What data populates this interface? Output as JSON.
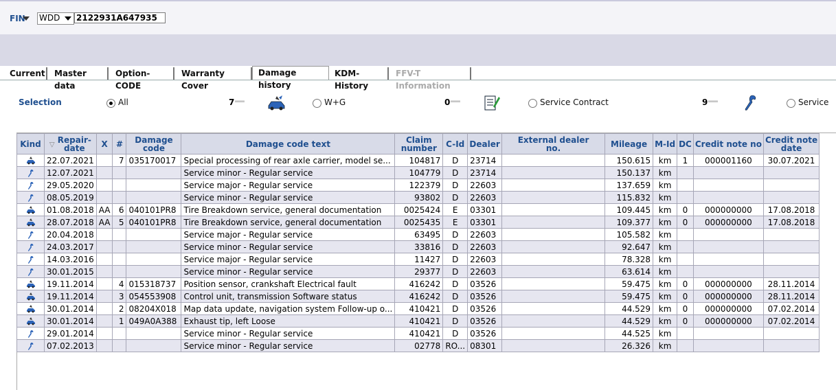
{
  "header": {
    "fin_label": "FIN",
    "model_select": "WDD",
    "vin_value": "2122931A647935"
  },
  "tabs": [
    {
      "label": "Current"
    },
    {
      "label": "Master data"
    },
    {
      "label": "Option-CODE"
    },
    {
      "label": "Warranty  Cover"
    },
    {
      "label": "Damage history"
    },
    {
      "label": "KDM-History"
    },
    {
      "label": "FFV-T Information"
    }
  ],
  "selection": {
    "label": "Selection",
    "options": [
      {
        "label": "All",
        "checked": true
      },
      {
        "label": "W+G",
        "checked": false
      },
      {
        "label": "Service Contract",
        "checked": false
      },
      {
        "label": "Service",
        "checked": false
      }
    ],
    "counts": [
      "7",
      "0",
      "9"
    ],
    "icons": [
      "damage-car-icon",
      "contract-document-icon",
      "wrench-icon"
    ]
  },
  "table": {
    "headers": [
      "Kind",
      "Repair-\ndate",
      "X",
      "#",
      "Damage\ncode",
      "Damage code text",
      "Claim\nnumber",
      "C-Id",
      "Dealer",
      "External dealer\nno.",
      "Mileage",
      "M-Id",
      "DC",
      "Credit note no",
      "Credit note\ndate"
    ],
    "rows": [
      {
        "kind": "damage",
        "date": "22.07.2021",
        "x": "",
        "num": "7",
        "code": "035170017",
        "text": "Special processing of rear axle carrier, model se...",
        "claim": "104817",
        "cid": "D",
        "dealer": "23714",
        "ext": "",
        "mileage": "150.615",
        "mid": "km",
        "dc": "1",
        "cn": "000001160",
        "cndate": "30.07.2021"
      },
      {
        "kind": "service",
        "date": "12.07.2021",
        "x": "",
        "num": "",
        "code": "",
        "text": "Service minor - Regular service",
        "claim": "104779",
        "cid": "D",
        "dealer": "23714",
        "ext": "",
        "mileage": "150.137",
        "mid": "km",
        "dc": "",
        "cn": "",
        "cndate": ""
      },
      {
        "kind": "service",
        "date": "29.05.2020",
        "x": "",
        "num": "",
        "code": "",
        "text": "Service major - Regular service",
        "claim": "122379",
        "cid": "D",
        "dealer": "22603",
        "ext": "",
        "mileage": "137.659",
        "mid": "km",
        "dc": "",
        "cn": "",
        "cndate": ""
      },
      {
        "kind": "service",
        "date": "08.05.2019",
        "x": "",
        "num": "",
        "code": "",
        "text": "Service minor - Regular service",
        "claim": "93802",
        "cid": "D",
        "dealer": "22603",
        "ext": "",
        "mileage": "115.832",
        "mid": "km",
        "dc": "",
        "cn": "",
        "cndate": ""
      },
      {
        "kind": "damage",
        "date": "01.08.2018",
        "x": "AA",
        "num": "6",
        "code": "040101PR8",
        "text": "Tire Breakdown service, general documentation",
        "claim": "0025424",
        "cid": "E",
        "dealer": "03301",
        "ext": "",
        "mileage": "109.445",
        "mid": "km",
        "dc": "0",
        "cn": "000000000",
        "cndate": "17.08.2018"
      },
      {
        "kind": "damage",
        "date": "28.07.2018",
        "x": "AA",
        "num": "5",
        "code": "040101PR8",
        "text": "Tire Breakdown service, general documentation",
        "claim": "0025435",
        "cid": "E",
        "dealer": "03301",
        "ext": "",
        "mileage": "109.377",
        "mid": "km",
        "dc": "0",
        "cn": "000000000",
        "cndate": "17.08.2018"
      },
      {
        "kind": "service",
        "date": "20.04.2018",
        "x": "",
        "num": "",
        "code": "",
        "text": "Service major - Regular service",
        "claim": "63495",
        "cid": "D",
        "dealer": "22603",
        "ext": "",
        "mileage": "105.582",
        "mid": "km",
        "dc": "",
        "cn": "",
        "cndate": ""
      },
      {
        "kind": "service",
        "date": "24.03.2017",
        "x": "",
        "num": "",
        "code": "",
        "text": "Service minor - Regular service",
        "claim": "33816",
        "cid": "D",
        "dealer": "22603",
        "ext": "",
        "mileage": "92.647",
        "mid": "km",
        "dc": "",
        "cn": "",
        "cndate": ""
      },
      {
        "kind": "service",
        "date": "14.03.2016",
        "x": "",
        "num": "",
        "code": "",
        "text": "Service major - Regular service",
        "claim": "11427",
        "cid": "D",
        "dealer": "22603",
        "ext": "",
        "mileage": "78.328",
        "mid": "km",
        "dc": "",
        "cn": "",
        "cndate": ""
      },
      {
        "kind": "service",
        "date": "30.01.2015",
        "x": "",
        "num": "",
        "code": "",
        "text": "Service minor - Regular service",
        "claim": "29377",
        "cid": "D",
        "dealer": "22603",
        "ext": "",
        "mileage": "63.614",
        "mid": "km",
        "dc": "",
        "cn": "",
        "cndate": ""
      },
      {
        "kind": "damage",
        "date": "19.11.2014",
        "x": "",
        "num": "4",
        "code": "015318737",
        "text": "Position sensor, crankshaft Electrical fault",
        "claim": "416242",
        "cid": "D",
        "dealer": "03526",
        "ext": "",
        "mileage": "59.475",
        "mid": "km",
        "dc": "0",
        "cn": "000000000",
        "cndate": "28.11.2014"
      },
      {
        "kind": "damage",
        "date": "19.11.2014",
        "x": "",
        "num": "3",
        "code": "054553908",
        "text": "Control unit, transmission Software status",
        "claim": "416242",
        "cid": "D",
        "dealer": "03526",
        "ext": "",
        "mileage": "59.475",
        "mid": "km",
        "dc": "0",
        "cn": "000000000",
        "cndate": "28.11.2014"
      },
      {
        "kind": "damage",
        "date": "30.01.2014",
        "x": "",
        "num": "2",
        "code": "08204X018",
        "text": "Map data update, navigation system Follow-up o...",
        "claim": "410421",
        "cid": "D",
        "dealer": "03526",
        "ext": "",
        "mileage": "44.529",
        "mid": "km",
        "dc": "0",
        "cn": "000000000",
        "cndate": "07.02.2014"
      },
      {
        "kind": "damage",
        "date": "30.01.2014",
        "x": "",
        "num": "1",
        "code": "049A0A388",
        "text": "Exhaust tip, left Loose",
        "claim": "410421",
        "cid": "D",
        "dealer": "03526",
        "ext": "",
        "mileage": "44.529",
        "mid": "km",
        "dc": "0",
        "cn": "000000000",
        "cndate": "07.02.2014"
      },
      {
        "kind": "service",
        "date": "29.01.2014",
        "x": "",
        "num": "",
        "code": "",
        "text": "Service minor - Regular service",
        "claim": "410421",
        "cid": "D",
        "dealer": "03526",
        "ext": "",
        "mileage": "44.525",
        "mid": "km",
        "dc": "",
        "cn": "",
        "cndate": ""
      },
      {
        "kind": "service",
        "date": "07.02.2013",
        "x": "",
        "num": "",
        "code": "",
        "text": "Service minor - Regular service",
        "claim": "02778",
        "cid": "RO...",
        "dealer": "08301",
        "ext": "",
        "mileage": "26.326",
        "mid": "km",
        "dc": "",
        "cn": "",
        "cndate": ""
      }
    ]
  },
  "colors": {
    "accent": "#1f4f8f",
    "header_bg": "#d8dbe8",
    "row_alt": "#e6e6f0"
  }
}
